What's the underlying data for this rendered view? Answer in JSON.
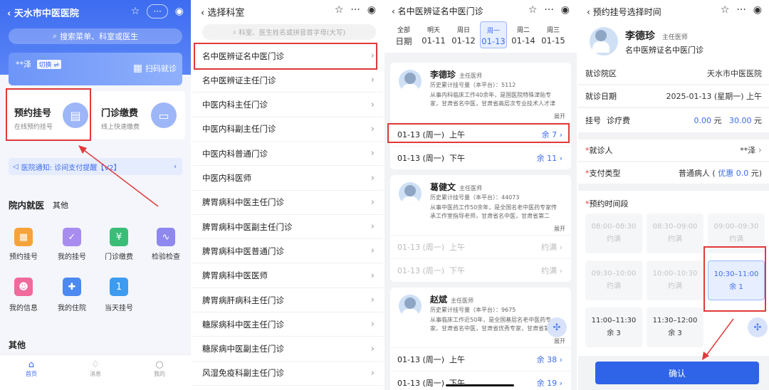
{
  "screen1": {
    "title": "天水市中医医院",
    "capsule": "···",
    "search_placeholder": "搜索菜单、科室或医生",
    "patient_name": "**泽",
    "switch_label": "切换",
    "scan_label": "扫码就诊",
    "appointment": {
      "title": "预约挂号",
      "subtitle": "在线预约挂号"
    },
    "payment": {
      "title": "门诊缴费",
      "subtitle": "线上快速缴费"
    },
    "notice": "医院通知: 诊间支付提醒【V2】",
    "sections": {
      "inhospital": "院内就医",
      "other_tab": "其他",
      "other": "其他"
    },
    "grid": [
      "预约挂号",
      "我的挂号",
      "门诊缴费",
      "检验检查",
      "我的信息",
      "我的住院",
      "当天挂号"
    ],
    "tabbar": [
      "首页",
      "消息",
      "我的"
    ]
  },
  "screen2": {
    "back_title": "选择科室",
    "search_placeholder": "科室、医生姓名或拼音首字母(大写)",
    "departments": [
      "名中医辨证名中医门诊",
      "名中医辨证主任门诊",
      "中医内科主任门诊",
      "中医内科副主任门诊",
      "中医内科普通门诊",
      "中医内科医师",
      "脾胃病科中医主任门诊",
      "脾胃病科中医副主任门诊",
      "脾胃病科中医普通门诊",
      "脾胃病科中医医师",
      "脾胃病肝病科主任门诊",
      "糖尿病科中医主任门诊",
      "糖尿病中医副主任门诊",
      "风湿免疫科副主任门诊"
    ]
  },
  "screen3": {
    "back_title": "名中医辨证名中医门诊",
    "dates": [
      {
        "top": "全部",
        "bottom": "日期"
      },
      {
        "top": "明天",
        "bottom": "01-11"
      },
      {
        "top": "周日",
        "bottom": "01-12"
      },
      {
        "top": "周一",
        "bottom": "01-13"
      },
      {
        "top": "周二",
        "bottom": "01-14"
      },
      {
        "top": "周三",
        "bottom": "01-15"
      }
    ],
    "doctors": [
      {
        "name": "李德珍",
        "title": "主任医师",
        "count": "历史累计挂号量（本平台）：5112",
        "bio": "从事内科临床工作40余年，是国医院特殊津贴专家，甘肃省名中医，甘肃省高层次专业技术人才津",
        "expand": "展开",
        "slots": [
          {
            "date": "01-13 (周一)",
            "period": "上午",
            "remain": "余 7"
          },
          {
            "date": "01-13 (周一)",
            "period": "下午",
            "remain": "余 11"
          }
        ]
      },
      {
        "name": "葛健文",
        "title": "主任医师",
        "count": "历史累计挂号量（本平台）：44073",
        "bio": "从事中医药工作50余年，是全国名老中医药专家传承工作室指导老师，甘肃省名中医，甘肃省第二",
        "expand": "展开",
        "slots": [
          {
            "date": "01-13 (周一)",
            "period": "上午",
            "remain": "约满"
          },
          {
            "date": "01-13 (周一)",
            "period": "下午",
            "remain": "约满"
          }
        ]
      },
      {
        "name": "赵斌",
        "title": "主任医师",
        "count": "历史累计挂号量（本平台）：9675",
        "bio": "从事临床工作近50年，是全国基层名老中医药专家、甘肃省名中医，甘肃省优秀专家，甘肃省第",
        "expand": "展开",
        "slots": [
          {
            "date": "01-13 (周一)",
            "period": "上午",
            "remain": "余 38"
          },
          {
            "date": "01-13 (周一)",
            "period": "下午",
            "remain": "余 19"
          }
        ]
      }
    ]
  },
  "screen4": {
    "back_title": "预约挂号选择时间",
    "doctor": {
      "name": "李德珍",
      "title": "主任医师",
      "dept": "名中医辨证名中医门诊"
    },
    "hospital": {
      "label": "就诊院区",
      "value": "天水市中医医院"
    },
    "date": {
      "label": "就诊日期",
      "value": "2025-01-13 (星期一) 上午"
    },
    "fee": {
      "label1": "挂号",
      "label2": "诊疗费",
      "reg": "0.00",
      "treat": "30.00",
      "unit": "元"
    },
    "patient": {
      "label": "就诊人",
      "value": "**泽"
    },
    "payment": {
      "label": "支付类型",
      "type": "普通病人 (",
      "discount_label": "优惠",
      "discount": "0.0",
      "unit_close": "元)"
    },
    "timeslot_label": "预约时间段",
    "slots": [
      {
        "time": "08:00–08:30",
        "status": "约满"
      },
      {
        "time": "08:30–09:00",
        "status": "约满"
      },
      {
        "time": "09:00–09:30",
        "status": "约满"
      },
      {
        "time": "09:30–10:00",
        "status": "约满"
      },
      {
        "time": "10:00–10:30",
        "status": "约满"
      },
      {
        "time": "10:30–11:00",
        "status": "余 1"
      },
      {
        "time": "11:00–11:30",
        "status": "余 3"
      },
      {
        "time": "11:30–12:00",
        "status": "余 3"
      }
    ],
    "confirm": "确认"
  },
  "colors": {
    "accent": "#3d6cf0",
    "highlight": "#e03a3a"
  }
}
